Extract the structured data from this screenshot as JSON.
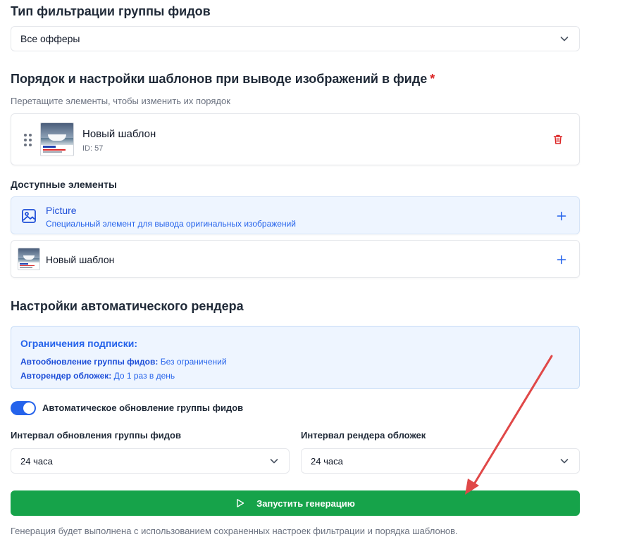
{
  "filter": {
    "title": "Тип фильтрации группы фидов",
    "selected": "Все офферы"
  },
  "templates": {
    "title": "Порядок и настройки шаблонов при выводе изображений в фиде",
    "required_mark": "*",
    "hint": "Перетащите элементы, чтобы изменить их порядок",
    "ordered": [
      {
        "name": "Новый шаблон",
        "id_label": "ID: 57"
      }
    ]
  },
  "available": {
    "title": "Доступные элементы",
    "items": [
      {
        "title": "Picture",
        "subtitle": "Специальный элемент для вывода оригинальных изображений"
      },
      {
        "title": "Новый шаблон"
      }
    ]
  },
  "autorender": {
    "title": "Настройки автоматического рендера",
    "limits": {
      "title": "Ограничения подписки:",
      "line1_label": "Автообновление группы фидов:",
      "line1_value": "Без ограничений",
      "line2_label": "Авторендер обложек:",
      "line2_value": "До 1 раз в день"
    },
    "toggle_label": "Автоматическое обновление группы фидов",
    "toggle_on": true,
    "interval_feeds_label": "Интервал обновления группы фидов",
    "interval_feeds_value": "24 часа",
    "interval_covers_label": "Интервал рендера обложек",
    "interval_covers_value": "24 часа"
  },
  "actions": {
    "run_label": "Запустить генерацию",
    "note": "Генерация будет выполнена с использованием сохраненных настроек фильтрации и порядка шаблонов."
  },
  "colors": {
    "accent": "#2563eb",
    "success": "#16a34a",
    "danger": "#dc2626",
    "annotation_arrow": "#e04848"
  }
}
